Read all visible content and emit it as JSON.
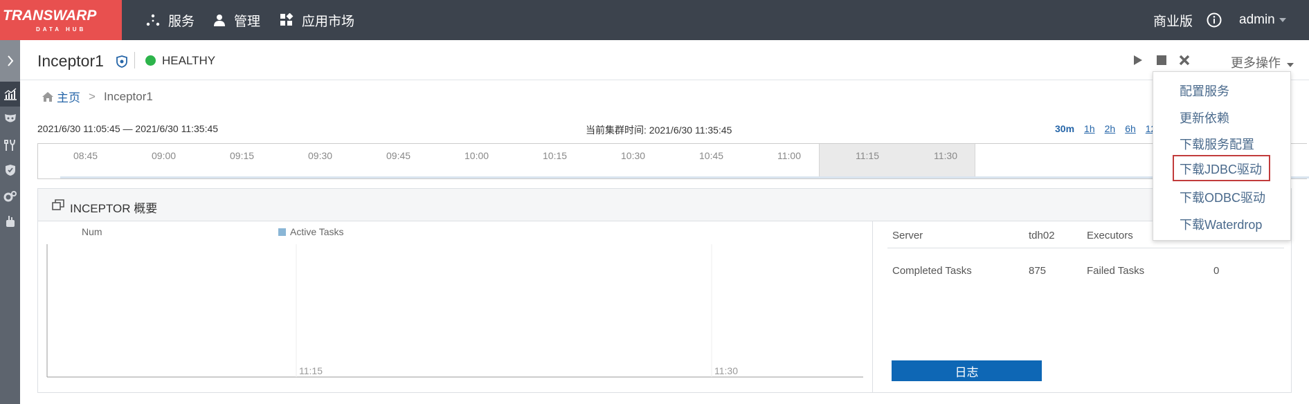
{
  "logo": {
    "main": "TRANSWARP",
    "sub": "DATA HUB"
  },
  "nav": [
    {
      "label": "服务",
      "icon": "services-icon"
    },
    {
      "label": "管理",
      "icon": "user-icon"
    },
    {
      "label": "应用市场",
      "icon": "app-market-icon"
    }
  ],
  "topRight": {
    "edition": "商业版",
    "user": "admin"
  },
  "service": {
    "name": "Inceptor1",
    "status": "HEALTHY",
    "moreLabel": "更多操作"
  },
  "breadcrumb": {
    "home": "主页",
    "separator": ">",
    "current": "Inceptor1"
  },
  "timeRange": {
    "range": "2021/6/30 11:05:45 — 2021/6/30 11:35:45",
    "cluster": "当前集群时间: 2021/6/30 11:35:45",
    "options": [
      "30m",
      "1h",
      "2h",
      "6h",
      "12"
    ],
    "selected": "30m"
  },
  "timeline": {
    "ticks": [
      "08:45",
      "09:00",
      "09:15",
      "09:30",
      "09:45",
      "10:00",
      "10:15",
      "10:30",
      "10:45",
      "11:00",
      "11:15",
      "11:30"
    ]
  },
  "overview": {
    "title": "INCEPTOR 概要",
    "chart": {
      "yLabel": "Num",
      "legend": "Active Tasks",
      "xTicks": [
        "11:15",
        "11:30"
      ]
    },
    "info": {
      "row1": [
        "Server",
        "tdh02",
        "Executors"
      ],
      "row2": [
        "Completed Tasks",
        "875",
        "Failed Tasks",
        "0"
      ]
    },
    "logButton": "日志"
  },
  "dropdown": {
    "items": [
      "配置服务",
      "更新依赖",
      "下载服务配置",
      "下载JDBC驱动",
      "下载ODBC驱动",
      "下载Waterdrop"
    ],
    "selectedIndex": 3
  },
  "colors": {
    "topbar": "#3c434d",
    "logo": "#e8504f",
    "healthy": "#2db44b",
    "primary": "#0e67b5",
    "highlightBorder": "#c23b3b"
  }
}
